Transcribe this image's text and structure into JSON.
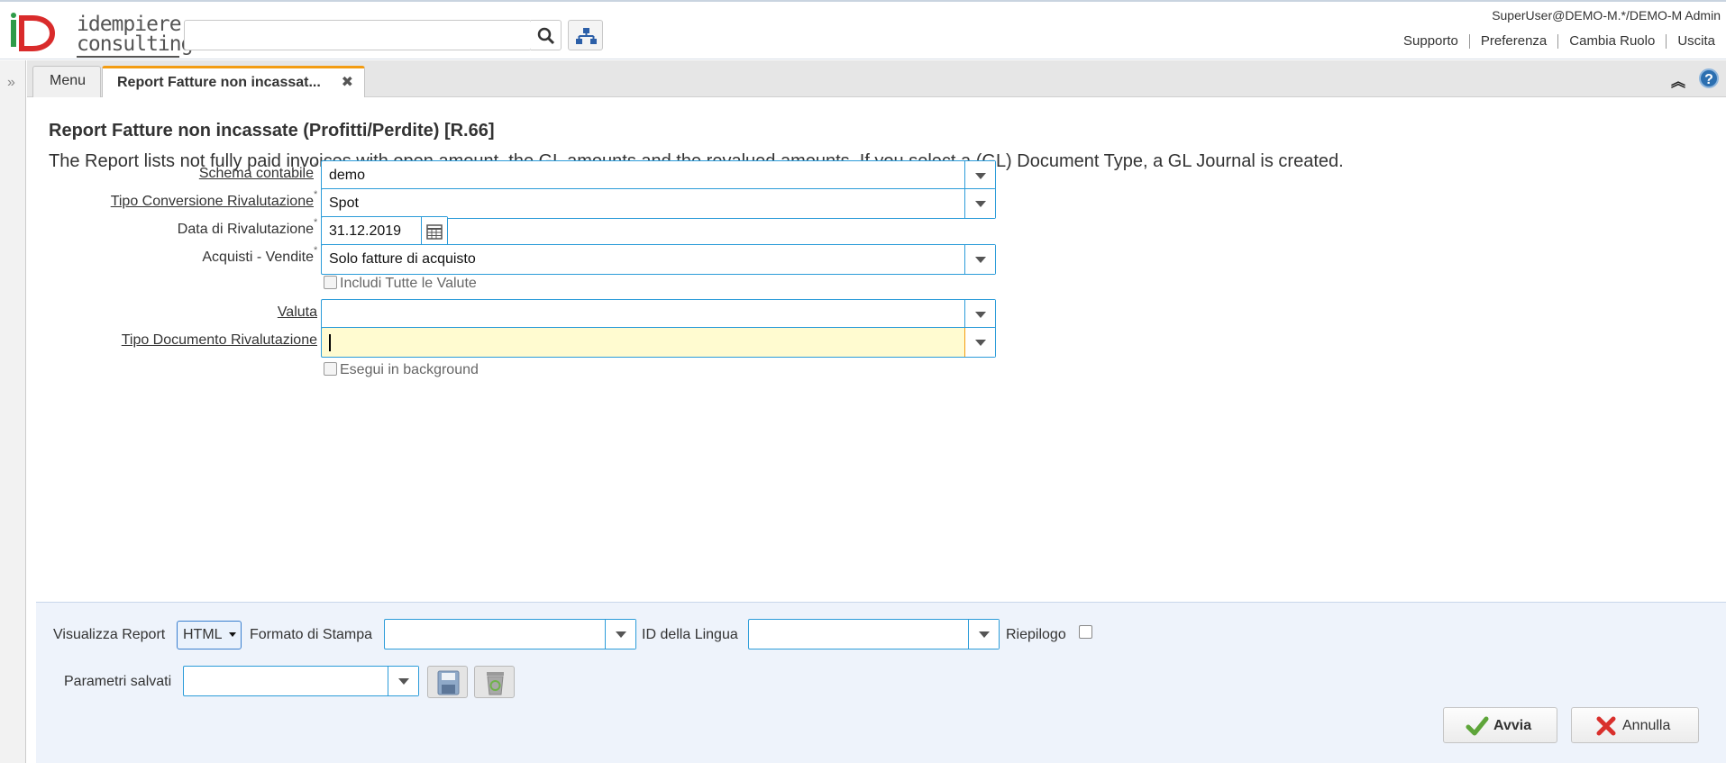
{
  "header": {
    "logo_text_line1": "idempiere",
    "logo_text_line2": "consulting",
    "search_placeholder": "",
    "user": "SuperUser@DEMO-M.*/DEMO-M Admin",
    "links": [
      "Supporto",
      "Preferenza",
      "Cambia Ruolo",
      "Uscita"
    ]
  },
  "tabs": {
    "menu_label": "Menu",
    "active_label": "Report Fatture non incassat..."
  },
  "process": {
    "title": "Report Fatture non incassate (Profitti/Perdite) [R.66]",
    "description": "The Report lists not fully paid invoices with open amount, the GL amounts and the revalued amounts. If you select a (GL) Document Type, a GL Journal is created."
  },
  "fields": {
    "schema_label": "Schema contabile",
    "schema_value": "demo",
    "tipo_conv_label": "Tipo Conversione Rivalutazione",
    "tipo_conv_value": "Spot",
    "data_label": "Data di Rivalutazione",
    "data_value": "31.12.2019",
    "acq_label": "Acquisti - Vendite",
    "acq_value": "Solo fatture di acquisto",
    "includi_label": "Includi Tutte le Valute",
    "valuta_label": "Valuta",
    "valuta_value": "",
    "tipo_doc_label": "Tipo Documento Rivalutazione",
    "tipo_doc_value": "",
    "background_label": "Esegui in background"
  },
  "bottom": {
    "visualizza_label": "Visualizza Report",
    "visualizza_value": "HTML",
    "formato_label": "Formato di Stampa",
    "formato_value": "",
    "lingua_label": "ID della Lingua",
    "lingua_value": "",
    "riepilogo_label": "Riepilogo",
    "parametri_label": "Parametri salvati",
    "parametri_value": "",
    "avvia_label": "Avvia",
    "annulla_label": "Annulla"
  },
  "colors": {
    "accent_tab": "#f39c12",
    "field_border": "#2c9cd9",
    "focus_bg": "#fffbd0",
    "bottom_bg": "#eef3fb"
  }
}
